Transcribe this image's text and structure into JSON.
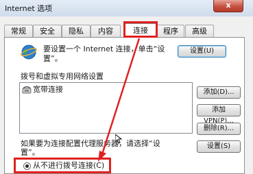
{
  "window": {
    "title": "Internet 选项",
    "close_label": "x"
  },
  "tabs": [
    {
      "label": "常规"
    },
    {
      "label": "安全"
    },
    {
      "label": "隐私"
    },
    {
      "label": "内容"
    },
    {
      "label": "连接"
    },
    {
      "label": "程序"
    },
    {
      "label": "高级"
    }
  ],
  "connections": {
    "setup_text": "要设置一个 Internet 连接，单击“设置”。",
    "setup_button": "设置(U)",
    "group_label": "拨号和虚拟专用网络设置",
    "list_items": [
      "宽带连接"
    ],
    "add_button": "添加(D)...",
    "add_vpn_button": "添加 VPN(P)...",
    "remove_button": "删除(R)...",
    "proxy_text": "如果要为连接配置代理服务器，请选择“设置”。",
    "settings_button": "设置(S)",
    "radio_never_dial": "从不进行拨号连接(C)"
  },
  "annotation": {
    "color": "#e02020"
  }
}
